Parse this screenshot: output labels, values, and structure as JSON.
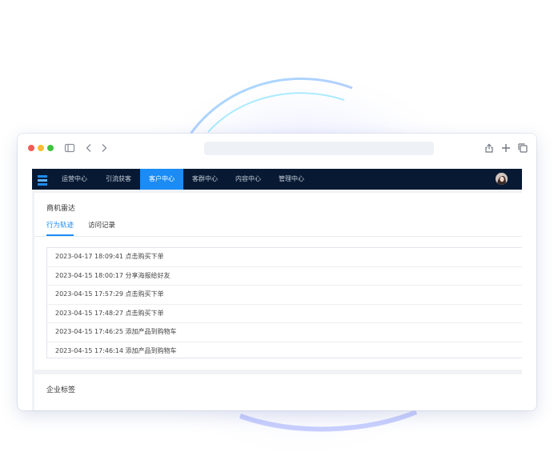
{
  "nav": {
    "items": [
      {
        "label": "运营中心",
        "active": false
      },
      {
        "label": "引流获客",
        "active": false
      },
      {
        "label": "客户中心",
        "active": true
      },
      {
        "label": "客群中心",
        "active": false
      },
      {
        "label": "内容中心",
        "active": false
      },
      {
        "label": "管理中心",
        "active": false
      }
    ]
  },
  "radar": {
    "title": "商机雷达",
    "tabs": [
      {
        "label": "行为轨迹",
        "active": true
      },
      {
        "label": "访问记录",
        "active": false
      }
    ],
    "events": [
      {
        "text": "2023-04-17 18:09:41 点击购买下单"
      },
      {
        "text": "2023-04-15 18:00:17 分享海报给好友"
      },
      {
        "text": "2023-04-15 17:57:29 点击购买下单"
      },
      {
        "text": "2023-04-15 17:48:27 点击购买下单"
      },
      {
        "text": "2023-04-15 17:46:25 添加产品到购物车"
      },
      {
        "text": "2023-04-15 17:46:14 添加产品到购物车"
      }
    ]
  },
  "tags": {
    "title": "企业标签"
  },
  "icons": [
    "sidebar-toggle-icon",
    "back-icon",
    "forward-icon",
    "share-icon",
    "new-tab-icon",
    "tabs-overview-icon",
    "app-logo-icon"
  ],
  "colors": {
    "nav_bg": "#081a33",
    "accent": "#1b8cf5"
  }
}
